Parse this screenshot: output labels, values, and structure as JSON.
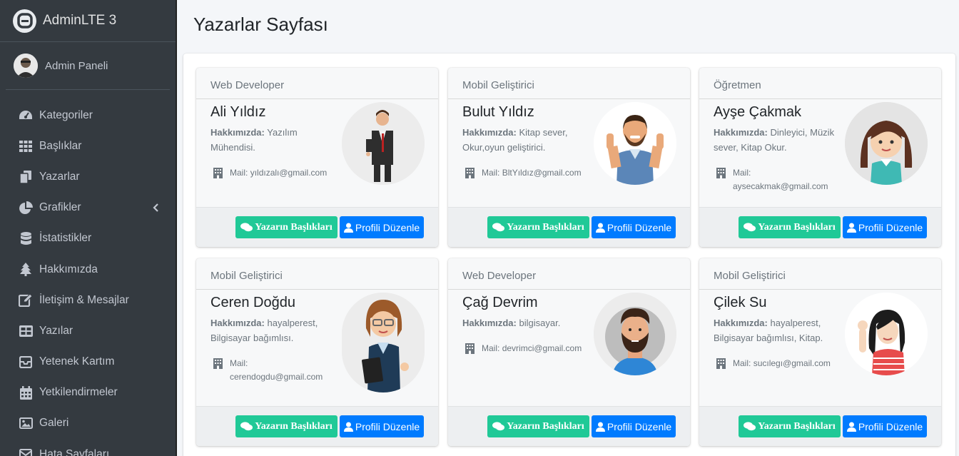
{
  "brand": {
    "title": "AdminLTE 3"
  },
  "user": {
    "name": "Admin Paneli"
  },
  "nav": [
    {
      "label": "Kategoriler",
      "icon": "tachometer-icon"
    },
    {
      "label": "Başlıklar",
      "icon": "grid-icon"
    },
    {
      "label": "Yazarlar",
      "icon": "copy-icon"
    },
    {
      "label": "Grafikler",
      "icon": "pie-chart-icon"
    },
    {
      "label": "İstatistikler",
      "icon": "database-icon"
    },
    {
      "label": "Hakkımızda",
      "icon": "tree-icon"
    },
    {
      "label": "İletişim & Mesajlar",
      "icon": "edit-icon"
    },
    {
      "label": "Yazılar",
      "icon": "table-icon"
    },
    {
      "label": "Yetenek Kartım",
      "icon": "envelope-box-icon"
    },
    {
      "label": "Yetkilendirmeler",
      "icon": "calendar-icon"
    },
    {
      "label": "Galeri",
      "icon": "image-icon"
    },
    {
      "label": "Hata Sayfaları",
      "icon": "envelope-icon"
    }
  ],
  "page": {
    "title": "Yazarlar Sayfası"
  },
  "labels": {
    "about": "Hakkımızda:",
    "mail": "Mail:",
    "posts_button": "Yazarın Başlıkları",
    "edit_button": "Profili Düzenle"
  },
  "writers": [
    {
      "role": "Web Developer",
      "name": "Ali Yıldız",
      "about": "Yazılım Mühendisi.",
      "email": "yıldızalı@gmail.com"
    },
    {
      "role": "Mobil Geliştirici",
      "name": "Bulut Yıldız",
      "about": "Kitap sever, Okur,oyun geliştirici.",
      "email": "BltYıldız@gmail.com"
    },
    {
      "role": "Öğretmen",
      "name": "Ayşe Çakmak",
      "about": "Dinleyici, Müzik sever, Kitap Okur.",
      "email": "aysecakmak@gmail.com"
    },
    {
      "role": "Mobil Geliştirici",
      "name": "Ceren Doğdu",
      "about": "hayalperest, Bilgisayar bağımlısı.",
      "email": "cerendogdu@gmail.com"
    },
    {
      "role": "Web Developer",
      "name": "Çağ Devrim",
      "about": "bilgisayar.",
      "email": "devrimci@gmail.com"
    },
    {
      "role": "Mobil Geliştirici",
      "name": "Çilek Su",
      "about": "hayalperest, Bilgisayar bağımlısı, Kitap.",
      "email": "sucılegı@gmail.com"
    }
  ],
  "colors": {
    "sidebar": "#343a40",
    "green": "#20c997",
    "blue": "#007bff"
  }
}
